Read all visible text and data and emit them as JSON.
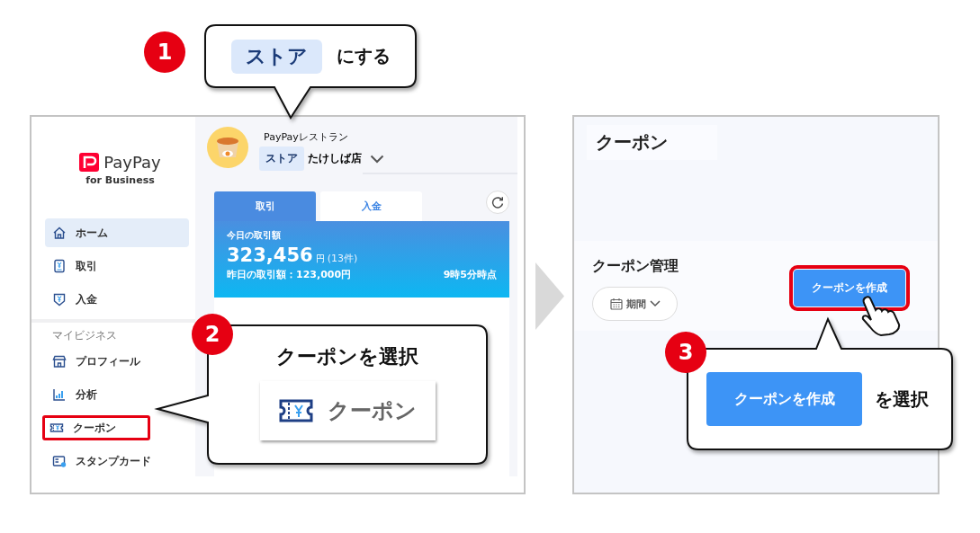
{
  "home_screen": {
    "logo": {
      "name": "PayPay",
      "subtitle": "for Business"
    },
    "sidebar": {
      "items": [
        {
          "label": "ホーム",
          "selected": true,
          "highlighted": false
        },
        {
          "label": "取引",
          "selected": false,
          "highlighted": false
        },
        {
          "label": "入金",
          "selected": false,
          "highlighted": false
        }
      ],
      "section": {
        "label": "マイビジネス",
        "items": [
          {
            "label": "プロフィール",
            "selected": false,
            "highlighted": false
          },
          {
            "label": "分析",
            "selected": false,
            "highlighted": false
          },
          {
            "label": "クーポン",
            "selected": false,
            "highlighted": true
          },
          {
            "label": "スタンプカード",
            "selected": false,
            "highlighted": false
          }
        ]
      }
    },
    "store": {
      "name": "PayPayレストラン",
      "type": "ストア",
      "branch": "たけしば店"
    },
    "tabs": [
      {
        "label": "取引",
        "selected": true
      },
      {
        "label": "入金",
        "selected": false
      }
    ],
    "summary": {
      "label": "今日の取引額",
      "amount": "323,456",
      "unit": "円",
      "count": "(13件)",
      "yesterday": "昨日の取引額：123,000円",
      "as_of": "9時5分時点"
    }
  },
  "coupon_screen": {
    "title": "クーポン",
    "section": "クーポン管理",
    "filter": "期間",
    "create_button": {
      "label": "クーポンを作成",
      "highlighted": true
    }
  },
  "callouts": [
    {
      "kind": "tag-note",
      "number": "1",
      "tag": "ストア",
      "text": "にする"
    },
    {
      "kind": "menu-sample",
      "number": "2",
      "title": "クーポンを選択",
      "sample": "クーポン"
    },
    {
      "kind": "button-note",
      "number": "3",
      "button": "クーポンを作成",
      "text": "を選択"
    }
  ]
}
